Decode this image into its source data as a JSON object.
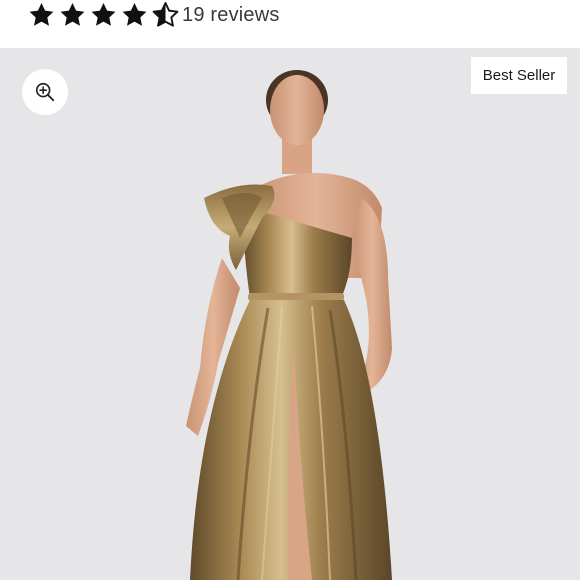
{
  "rating": {
    "stars_value": 4.5,
    "stars_max": 5,
    "reviews_label": "19 reviews"
  },
  "gallery": {
    "badge_label": "Best Seller",
    "icons": {
      "zoom": "zoom-in-icon",
      "star": "star-icon"
    }
  },
  "colors": {
    "star_fill": "#111111",
    "gallery_bg": "#e6e6e9",
    "dress_gold": "#9a7b4a"
  }
}
